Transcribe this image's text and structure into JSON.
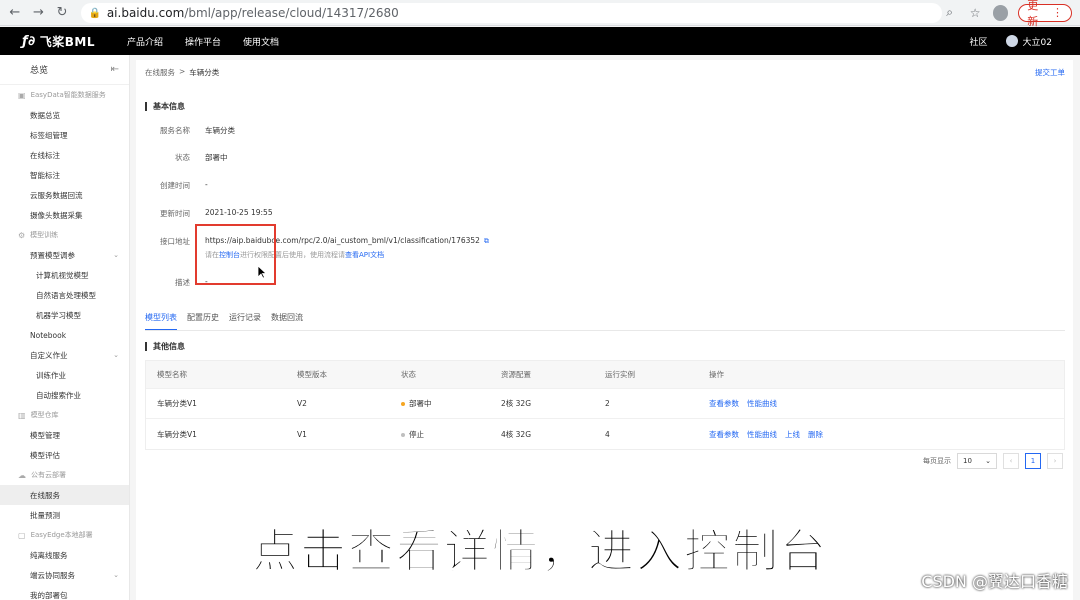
{
  "browser": {
    "url_host": "ai.baidu.com",
    "url_path": "/bml/app/release/cloud/14317/2680",
    "update_label": "更新"
  },
  "topnav": {
    "logo": "飞桨BML",
    "logo_mark": "ƒ∂",
    "menu": [
      "产品介绍",
      "操作平台",
      "使用文档"
    ],
    "community": "社区",
    "user": "大立02"
  },
  "sidebar": {
    "title": "总览",
    "groups": [
      {
        "label": "EasyData智能数据服务",
        "items": [
          {
            "label": "数据总览"
          },
          {
            "label": "标签组管理"
          },
          {
            "label": "在线标注"
          },
          {
            "label": "智能标注"
          },
          {
            "label": "云服务数据回流"
          },
          {
            "label": "摄像头数据采集"
          }
        ]
      },
      {
        "label": "模型训练",
        "items": [
          {
            "label": "预置模型调参",
            "expandable": true
          },
          {
            "label": "计算机视觉模型",
            "sub": true
          },
          {
            "label": "自然语言处理模型",
            "sub": true
          },
          {
            "label": "机器学习模型",
            "sub": true
          },
          {
            "label": "Notebook"
          },
          {
            "label": "自定义作业",
            "expandable": true
          },
          {
            "label": "训练作业",
            "sub": true
          },
          {
            "label": "自动搜索作业",
            "sub": true
          }
        ]
      },
      {
        "label": "模型仓库",
        "items": [
          {
            "label": "模型管理"
          },
          {
            "label": "模型评估"
          }
        ]
      },
      {
        "label": "公有云部署",
        "items": [
          {
            "label": "在线服务",
            "active": true
          },
          {
            "label": "批量预测"
          }
        ]
      },
      {
        "label": "EasyEdge本地部署",
        "items": [
          {
            "label": "纯离线服务"
          },
          {
            "label": "端云协同服务",
            "expandable": true
          },
          {
            "label": "我的部署包"
          }
        ]
      }
    ]
  },
  "main": {
    "breadcrumb": [
      "在线服务",
      "车辆分类"
    ],
    "breadcrumb_sep": ">",
    "ticket": "提交工单",
    "basic_title": "基本信息",
    "fields": [
      {
        "key": "服务名称",
        "value": "车辆分类"
      },
      {
        "key": "状态",
        "value": "部署中"
      },
      {
        "key": "创建时间",
        "value": "-"
      },
      {
        "key": "更新时间",
        "value": "2021-10-25 19:55"
      },
      {
        "key": "接口地址",
        "value": "https://aip.baidubce.com/rpc/2.0/ai_custom_bml/v1/classification/176352"
      },
      {
        "key": "描述",
        "value": "-"
      }
    ],
    "hint_prefix": "请在",
    "hint_link1": "控制台",
    "hint_middle": "进行权限配置后使用，使用流程请",
    "hint_link2": "查看API文档",
    "tabs": [
      "模型列表",
      "配置历史",
      "运行记录",
      "数据回流"
    ],
    "other_title": "其他信息",
    "table": {
      "headers": [
        "模型名称",
        "模型版本",
        "状态",
        "资源配置",
        "运行实例",
        "操作"
      ],
      "rows": [
        {
          "name": "车辆分类V1",
          "version": "V2",
          "status": "部署中",
          "status_color": "#f5a623",
          "resource": "2核 32G",
          "instances": "2",
          "ops": [
            "查看参数",
            "性能曲线"
          ]
        },
        {
          "name": "车辆分类V1",
          "version": "V1",
          "status": "停止",
          "status_color": "#bfbfbf",
          "resource": "4核 32G",
          "instances": "4",
          "ops": [
            "查看参数",
            "性能曲线",
            "上线",
            "删除"
          ]
        }
      ]
    },
    "pager": {
      "label": "每页显示",
      "page_size": "10",
      "current": "1"
    }
  },
  "subtitle": "点击查看详情，进入控制台",
  "watermark": "CSDN @翼达口香糖",
  "colors": {
    "accent": "#2468f2",
    "highlight": "#e23b2e",
    "nav_bg": "#000000"
  }
}
